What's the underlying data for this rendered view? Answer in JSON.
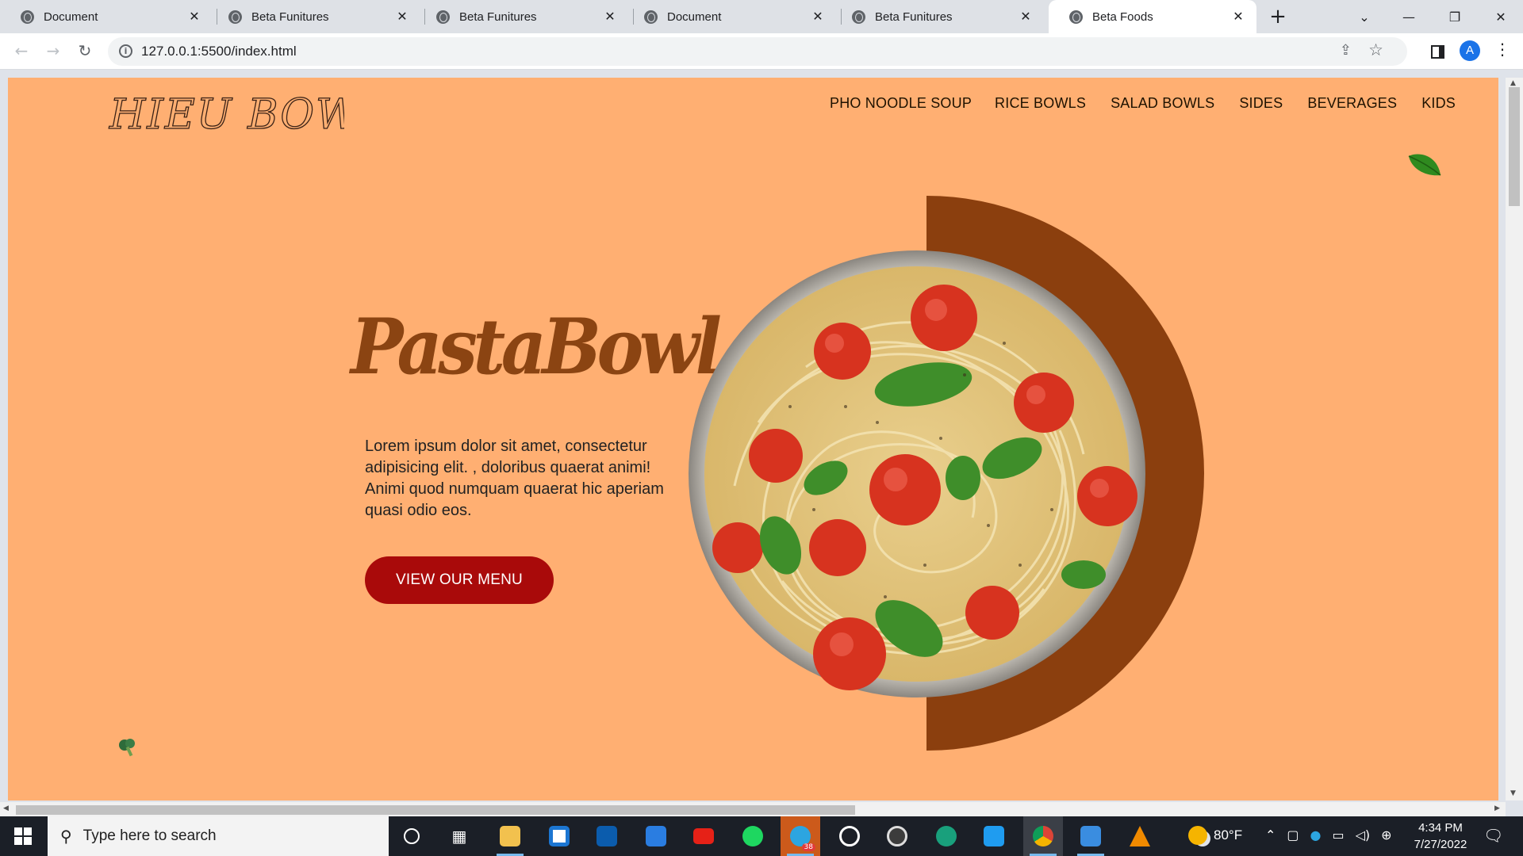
{
  "browser": {
    "tabs": [
      {
        "title": "Document",
        "active": false
      },
      {
        "title": "Beta Funitures",
        "active": false
      },
      {
        "title": "Beta Funitures",
        "active": false
      },
      {
        "title": "Document",
        "active": false
      },
      {
        "title": "Beta Funitures",
        "active": false
      },
      {
        "title": "Beta Foods",
        "active": true
      }
    ],
    "url": "127.0.0.1:5500/index.html",
    "profile_initial": "A",
    "colors": {
      "tab_strip": "#dee1e6",
      "profile": "#1a73e8"
    }
  },
  "site": {
    "logo_text": "HIEU BOWL",
    "nav": [
      "PHO NOODLE SOUP",
      "RICE BOWLS",
      "SALAD BOWLS",
      "SIDES",
      "BEVERAGES",
      "KIDS"
    ],
    "heading": "PastaBowl",
    "description": "Lorem ipsum dolor sit amet, consectetur adipisicing elit. , doloribus quaerat animi! Animi quod numquam quaerat hic aperiam quasi odio eos.",
    "cta_label": "VIEW OUR MENU",
    "colors": {
      "background": "#ffaf72",
      "heading": "#8b4412",
      "cta": "#a90a0a",
      "half_circle": "#8b3f0e"
    }
  },
  "taskbar": {
    "search_placeholder": "Type here to search",
    "pinned_apps": [
      "cortana",
      "task-view",
      "file-explorer",
      "microsoft-store",
      "microsoft-store",
      "mail",
      "youtube",
      "spotify",
      "telegram",
      "whatsapp",
      "obs",
      "edge",
      "vscode",
      "chrome",
      "photos",
      "vlc"
    ],
    "telegram_badge": "38",
    "weather_temp": "80°F",
    "time": "4:34 PM",
    "date": "7/27/2022"
  }
}
